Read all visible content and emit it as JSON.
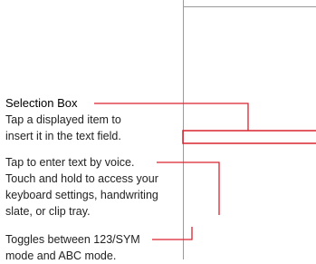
{
  "colors": {
    "callout_line": "#d9232e",
    "device_outline": "#9a9a9a",
    "text": "#222222"
  },
  "callouts": [
    {
      "title": "Selection Box",
      "lines": [
        "Tap a displayed item to",
        "insert it in the text field."
      ]
    },
    {
      "title": "",
      "lines": [
        "Tap to enter text by voice.",
        "Touch and hold to access your",
        "keyboard settings, handwriting",
        "slate, or clip tray."
      ]
    },
    {
      "title": "",
      "lines": [
        "Toggles between 123/SYM",
        "mode and ABC mode."
      ]
    }
  ]
}
